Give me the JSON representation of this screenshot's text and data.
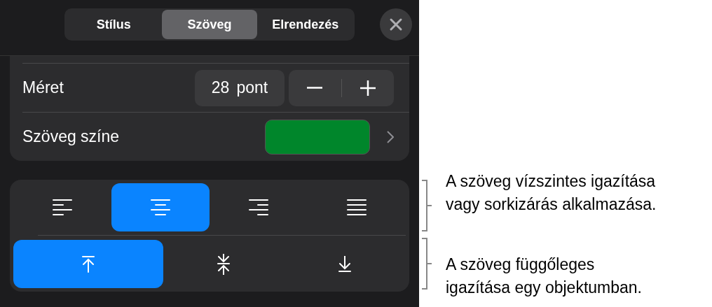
{
  "tabs": [
    {
      "label": "Stílus",
      "selected": false
    },
    {
      "label": "Szöveg",
      "selected": true
    },
    {
      "label": "Elrendezés",
      "selected": false
    }
  ],
  "size": {
    "label": "Méret",
    "value": "28",
    "unit": "pont"
  },
  "text_color": {
    "label": "Szöveg színe",
    "color": "#00862b"
  },
  "horizontal_alignment": [
    {
      "kind": "left",
      "selected": false
    },
    {
      "kind": "center",
      "selected": true
    },
    {
      "kind": "right",
      "selected": false
    },
    {
      "kind": "justify",
      "selected": false
    }
  ],
  "vertical_alignment": [
    {
      "kind": "top",
      "selected": true
    },
    {
      "kind": "middle",
      "selected": false
    },
    {
      "kind": "bottom",
      "selected": false
    }
  ],
  "callouts": [
    "A szöveg vízszintes igazítása\nvagy sorkizárás alkalmazása.",
    "A szöveg függőleges\nigazítása egy objektumban."
  ]
}
